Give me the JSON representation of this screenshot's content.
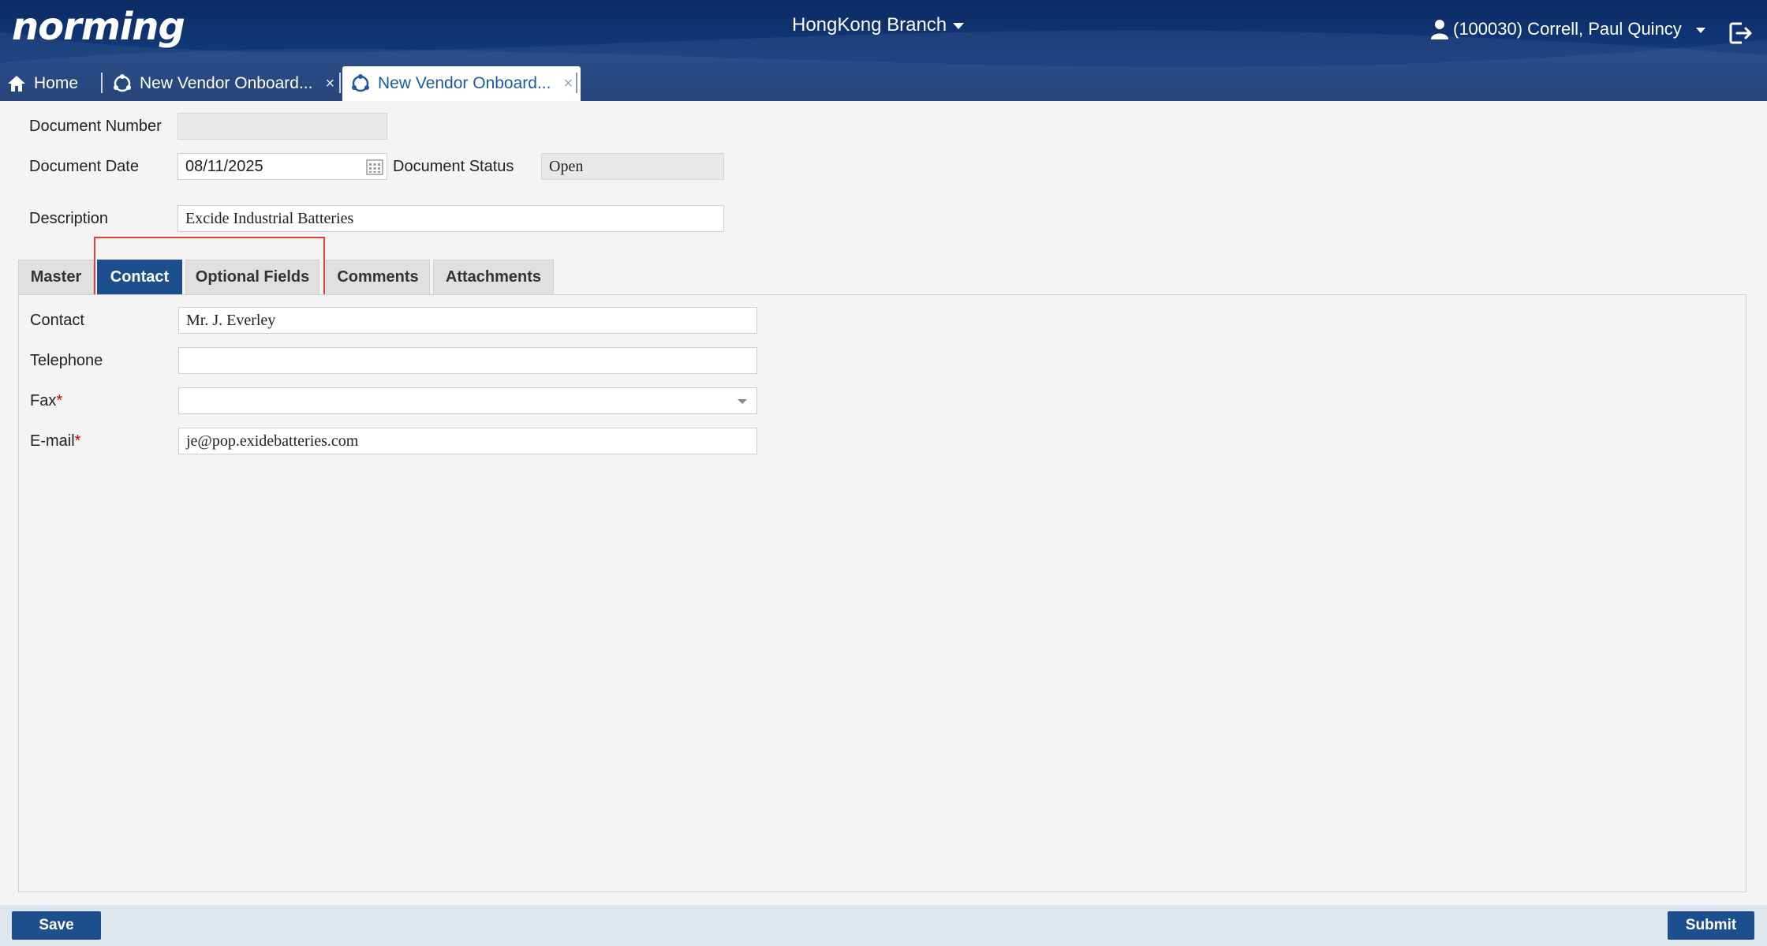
{
  "header": {
    "logo": "norming",
    "branch": "HongKong Branch",
    "user": "(100030) Correll, Paul Quincy"
  },
  "app_tabs": [
    {
      "label": "Home"
    },
    {
      "label": "New Vendor Onboard...",
      "close": "×"
    },
    {
      "label": "New Vendor Onboard...",
      "close": "×"
    }
  ],
  "form": {
    "document_number": {
      "label": "Document Number",
      "value": ""
    },
    "document_date": {
      "label": "Document Date",
      "value": "08/11/2025"
    },
    "document_status": {
      "label": "Document Status",
      "value": "Open"
    },
    "description": {
      "label": "Description",
      "value": "Excide Industrial Batteries"
    }
  },
  "sub_tabs": [
    {
      "label": "Master"
    },
    {
      "label": "Contact",
      "active": true
    },
    {
      "label": "Optional Fields"
    },
    {
      "label": "Comments"
    },
    {
      "label": "Attachments"
    }
  ],
  "contact": {
    "contact": {
      "label": "Contact",
      "value": "Mr. J. Everley"
    },
    "telephone": {
      "label": "Telephone",
      "value": ""
    },
    "fax": {
      "label": "Fax",
      "required_mark": "*",
      "value": ""
    },
    "email": {
      "label": "E-mail",
      "required_mark": "*",
      "value": "je@pop.exidebatteries.com"
    }
  },
  "footer": {
    "save_label": "Save",
    "submit_label": "Submit"
  },
  "colors": {
    "header_bg": "#0e2f6a",
    "accent": "#1d4f8f",
    "highlight": "#e0403a",
    "required": "#d00000"
  }
}
